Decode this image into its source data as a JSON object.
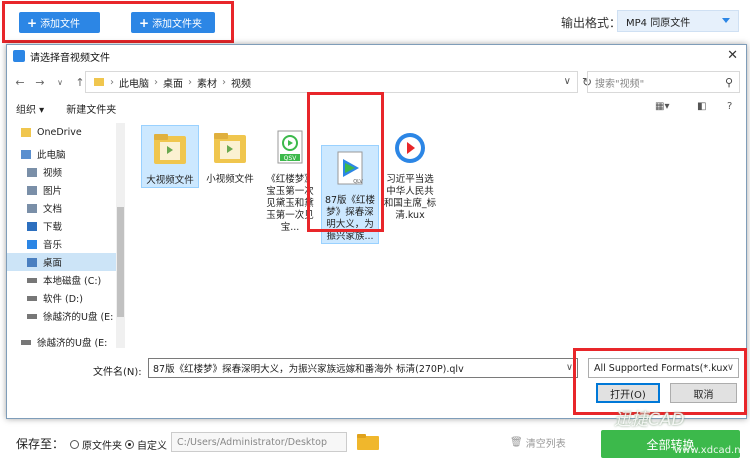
{
  "app": {
    "add_file": "添加文件",
    "add_folder": "添加文件夹",
    "output_format_label": "输出格式：",
    "output_format_value": "MP4  同原文件"
  },
  "dialog": {
    "title": "请选择音视频文件",
    "breadcrumb": [
      "此电脑",
      "桌面",
      "素材",
      "视频"
    ],
    "search_placeholder": "搜索\"视频\"",
    "toolbar": {
      "organize": "组织 ▾",
      "new_folder": "新建文件夹"
    },
    "nav": [
      {
        "label": "OneDrive",
        "icon": "onedrive-icon",
        "color": "#f0c64e"
      },
      {
        "label": "此电脑",
        "icon": "computer-icon",
        "color": "#5a8fcf"
      },
      {
        "label": "视频",
        "icon": "video-folder-icon",
        "color": "#7a8fa8"
      },
      {
        "label": "图片",
        "icon": "picture-folder-icon",
        "color": "#7a8fa8"
      },
      {
        "label": "文档",
        "icon": "document-folder-icon",
        "color": "#7a8fa8"
      },
      {
        "label": "下载",
        "icon": "download-icon",
        "color": "#2c6fbf"
      },
      {
        "label": "音乐",
        "icon": "music-icon",
        "color": "#2c86e5"
      },
      {
        "label": "桌面",
        "icon": "desktop-icon",
        "color": "#4a7fc0"
      },
      {
        "label": "本地磁盘 (C:)",
        "icon": "drive-icon",
        "color": "#777"
      },
      {
        "label": "软件 (D:)",
        "icon": "drive-icon",
        "color": "#777"
      },
      {
        "label": "徐越济的U盘 (E:",
        "icon": "usb-drive-icon",
        "color": "#777"
      },
      {
        "label": "徐越济的U盘 (E:",
        "icon": "usb-drive-icon",
        "color": "#777"
      }
    ],
    "files": [
      {
        "name": "大视频文件",
        "type": "folder"
      },
      {
        "name": "小视频文件",
        "type": "folder"
      },
      {
        "name": "《红楼梦》宝玉第一次见黛玉和黛玉第一次见宝...",
        "type": "qsv",
        "badge": "QSV"
      },
      {
        "name": "87版《红楼梦》探春深明大义，为振兴家族...",
        "type": "qlv",
        "badge": "QLV"
      },
      {
        "name": "习近平当选中华人民共和国主席_标清.kux",
        "type": "kux"
      }
    ],
    "filename_label": "文件名(N):",
    "filename_value": "87版《红楼梦》探春深明大义，为振兴家族远嫁和番海外 标清(270P).qlv",
    "filetype_value": "All Supported Formats(*.kux",
    "open_btn": "打开(O)",
    "cancel_btn": "取消"
  },
  "savebar": {
    "label": "保存至：",
    "opt_original": "原文件夹",
    "opt_custom": "自定义",
    "path": "C:/Users/Administrator/Desktop",
    "clear_list": "清空列表",
    "convert": "全部转换"
  },
  "watermark": {
    "line1": "迅捷CAD",
    "line2": "www.xdcad.net"
  },
  "colors": {
    "accent": "#2c86e5",
    "highlight": "#e8262a",
    "green": "#3cb94b"
  }
}
